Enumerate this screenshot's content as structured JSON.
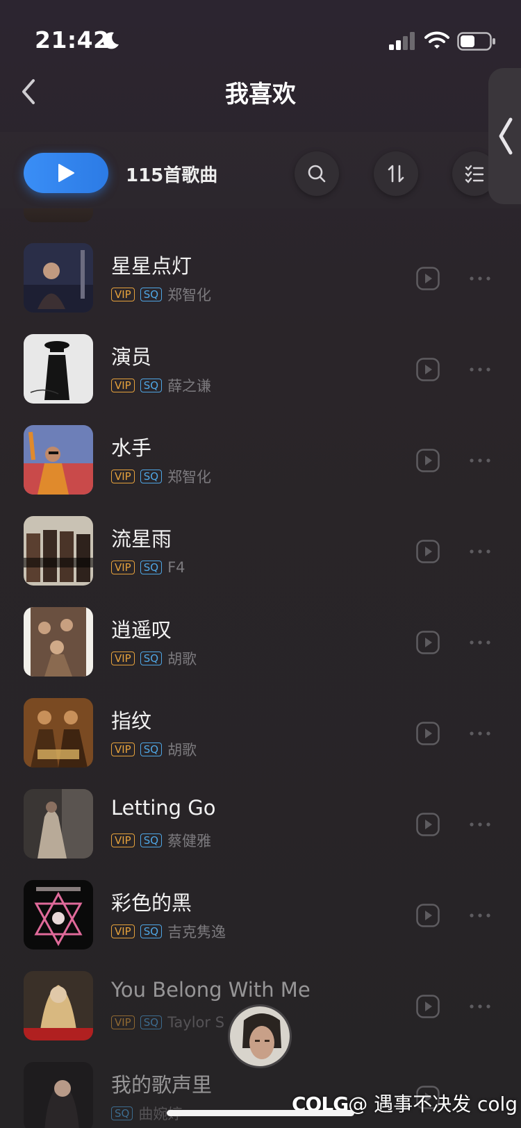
{
  "status": {
    "time": "21:42"
  },
  "header": {
    "title": "我喜欢"
  },
  "toolbar": {
    "song_count": "115首歌曲"
  },
  "songs": [
    {
      "title": "星星点灯",
      "vip": "VIP",
      "sq": "SQ",
      "artist": "郑智化"
    },
    {
      "title": "演员",
      "vip": "VIP",
      "sq": "SQ",
      "artist": "薛之谦"
    },
    {
      "title": "水手",
      "vip": "VIP",
      "sq": "SQ",
      "artist": "郑智化"
    },
    {
      "title": "流星雨",
      "vip": "VIP",
      "sq": "SQ",
      "artist": "F4"
    },
    {
      "title": "逍遥叹",
      "vip": "VIP",
      "sq": "SQ",
      "artist": "胡歌"
    },
    {
      "title": "指纹",
      "vip": "VIP",
      "sq": "SQ",
      "artist": "胡歌"
    },
    {
      "title": "Letting Go",
      "vip": "VIP",
      "sq": "SQ",
      "artist": "蔡健雅"
    },
    {
      "title": "彩色的黑",
      "vip": "VIP",
      "sq": "SQ",
      "artist": "吉克隽逸"
    },
    {
      "title": "You Belong With Me",
      "vip": "VIP",
      "sq": "SQ",
      "artist": "Taylor S"
    },
    {
      "title": "我的歌声里",
      "sq": "SQ",
      "artist": "曲婉婷"
    }
  ],
  "watermark": {
    "brand": "COLG",
    "text": "@ 遇事不决发 colg"
  },
  "colors": {
    "accent": "#2c7be5",
    "vip": "#e6a23c",
    "sq": "#4fa7e6"
  }
}
